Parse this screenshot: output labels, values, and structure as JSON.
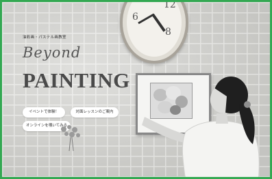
{
  "hero": {
    "subtitle": "油彩画・パステル画教室",
    "brand_script": "Beyond",
    "brand_main": "PAINTING"
  },
  "buttons": {
    "events": "イベントで体験！",
    "trial": "対面レッスンのご案内",
    "online": "オンラインを覗いてみる"
  },
  "colors": {
    "border_accent": "#33a852",
    "title_text": "#4a4a4a"
  }
}
